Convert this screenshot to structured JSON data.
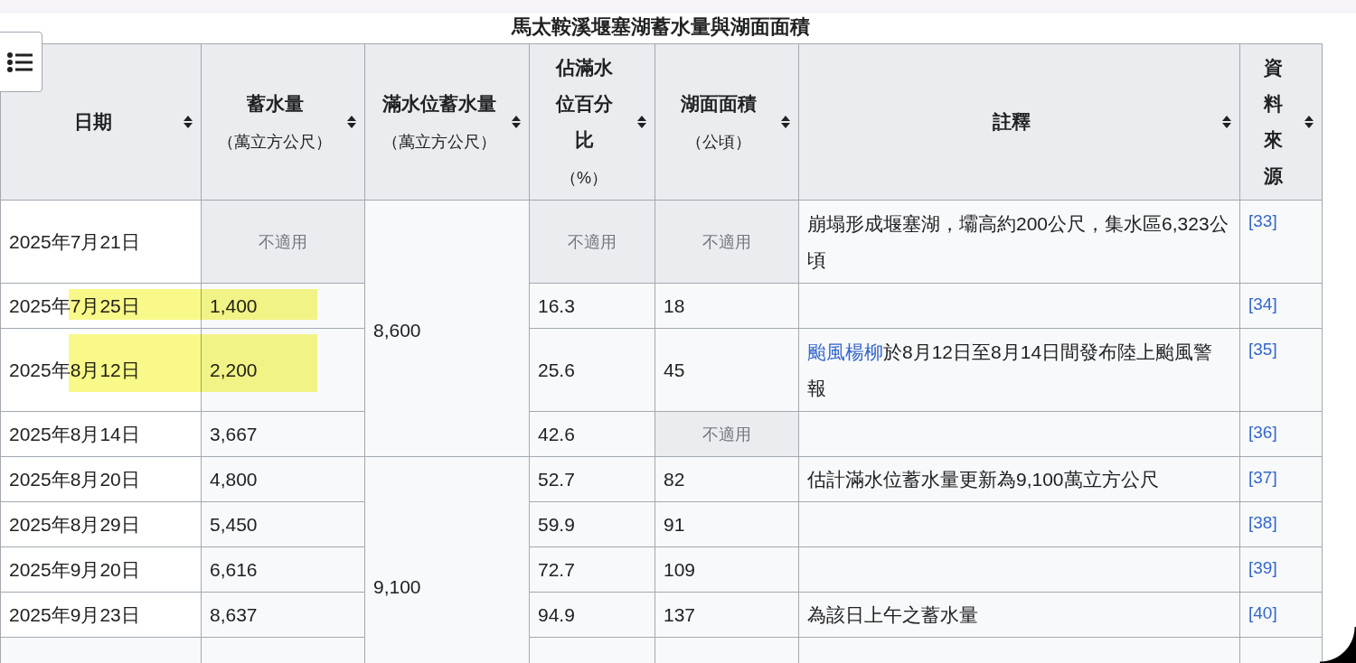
{
  "table": {
    "caption": "馬太鞍溪堰塞湖蓄水量與湖面面積",
    "columns": [
      {
        "title": "日期"
      },
      {
        "title": "蓄水量",
        "unit": "（萬立方公尺）"
      },
      {
        "title": "滿水位蓄水量",
        "unit": "（萬立方公尺）"
      },
      {
        "title": "佔滿水位百分比",
        "unit": "（%）"
      },
      {
        "title": "湖面面積",
        "unit": "（公頃）"
      },
      {
        "title": "註釋"
      },
      {
        "title": "資料來源"
      }
    ],
    "groups": [
      {
        "full_capacity": "8,600",
        "rows": [
          {
            "date": "2025年7月21日",
            "highlighted": false,
            "storage": {
              "text": "不適用",
              "not_applicable": true
            },
            "percent": {
              "text": "不適用",
              "not_applicable": true
            },
            "area": {
              "text": "不適用",
              "not_applicable": true
            },
            "note": [
              {
                "text": "崩塌形成堰塞湖，壩高約200公尺，集水區6,323公頃",
                "link": false
              }
            ],
            "source": "[33]"
          },
          {
            "date": "2025年7月25日",
            "highlighted": true,
            "storage": {
              "text": "1,400",
              "not_applicable": false
            },
            "percent": {
              "text": "16.3",
              "not_applicable": false
            },
            "area": {
              "text": "18",
              "not_applicable": false
            },
            "source": "[34]"
          },
          {
            "date": "2025年8月12日",
            "highlighted": true,
            "storage": {
              "text": "2,200",
              "not_applicable": false
            },
            "percent": {
              "text": "25.6",
              "not_applicable": false
            },
            "area": {
              "text": "45",
              "not_applicable": false
            },
            "note": [
              {
                "text": "颱風楊柳",
                "link": true
              },
              {
                "text": "於8月12日至8月14日間發布陸上颱風警報",
                "link": false
              }
            ],
            "source": "[35]"
          },
          {
            "date": "2025年8月14日",
            "highlighted": false,
            "storage": {
              "text": "3,667",
              "not_applicable": false
            },
            "percent": {
              "text": "42.6",
              "not_applicable": false
            },
            "area": {
              "text": "不適用",
              "not_applicable": true
            },
            "source": "[36]"
          }
        ]
      },
      {
        "full_capacity": "9,100",
        "rows": [
          {
            "date": "2025年8月20日",
            "highlighted": false,
            "storage": {
              "text": "4,800",
              "not_applicable": false
            },
            "percent": {
              "text": "52.7",
              "not_applicable": false
            },
            "area": {
              "text": "82",
              "not_applicable": false
            },
            "note": [
              {
                "text": "估計滿水位蓄水量更新為9,100萬立方公尺",
                "link": false
              }
            ],
            "source": "[37]"
          },
          {
            "date": "2025年8月29日",
            "highlighted": false,
            "storage": {
              "text": "5,450",
              "not_applicable": false
            },
            "percent": {
              "text": "59.9",
              "not_applicable": false
            },
            "area": {
              "text": "91",
              "not_applicable": false
            },
            "source": "[38]"
          },
          {
            "date": "2025年9月20日",
            "highlighted": false,
            "storage": {
              "text": "6,616",
              "not_applicable": false
            },
            "percent": {
              "text": "72.7",
              "not_applicable": false
            },
            "area": {
              "text": "109",
              "not_applicable": false
            },
            "source": "[39]"
          },
          {
            "date": "2025年9月23日",
            "highlighted": false,
            "storage": {
              "text": "8,637",
              "not_applicable": false
            },
            "percent": {
              "text": "94.9",
              "not_applicable": false
            },
            "area": {
              "text": "137",
              "not_applicable": false
            },
            "note": [
              {
                "text": "為該日上午之蓄水量",
                "link": false
              }
            ],
            "source": "[40]"
          }
        ]
      }
    ]
  }
}
